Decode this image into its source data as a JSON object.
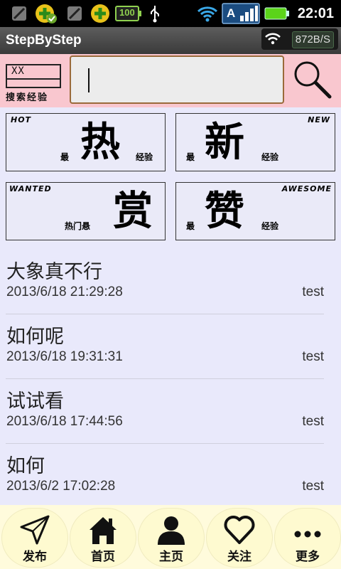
{
  "status_bar": {
    "time": "22:01",
    "battery_level": "100",
    "signal_label": "A",
    "icons": [
      "no-sim-icon",
      "app-update-icon",
      "no-sim-icon",
      "add-icon",
      "battery-100-icon",
      "usb-icon",
      "wifi-icon",
      "signal-icon",
      "battery-icon"
    ]
  },
  "title_bar": {
    "title": "StepByStep",
    "net_rate": "872B/S"
  },
  "search": {
    "logo_text": "XX",
    "logo_label": "搜索经验",
    "input_value": "",
    "accent": "#f9c7cf"
  },
  "tiles": [
    {
      "tag": "HOT",
      "big": "热",
      "left": "最",
      "right": "经验"
    },
    {
      "tag": "NEW",
      "big": "新",
      "left": "最",
      "right": "经验"
    },
    {
      "tag": "WANTED",
      "big": "赏",
      "left": "热门悬",
      "right": ""
    },
    {
      "tag": "AWESOME",
      "big": "赞",
      "left": "最",
      "right": "经验"
    }
  ],
  "posts": [
    {
      "title": "大象真不行",
      "date": "2013/6/18 21:29:28",
      "user": "test"
    },
    {
      "title": "如何呢",
      "date": "2013/6/18 19:31:31",
      "user": "test"
    },
    {
      "title": "试试看",
      "date": "2013/6/18 17:44:56",
      "user": "test"
    },
    {
      "title": "如何",
      "date": "2013/6/2 17:02:28",
      "user": "test"
    }
  ],
  "nav": [
    {
      "label": "发布",
      "icon": "send-icon"
    },
    {
      "label": "首页",
      "icon": "home-icon"
    },
    {
      "label": "主页",
      "icon": "person-icon"
    },
    {
      "label": "关注",
      "icon": "heart-icon"
    },
    {
      "label": "更多",
      "icon": "more-icon"
    }
  ]
}
